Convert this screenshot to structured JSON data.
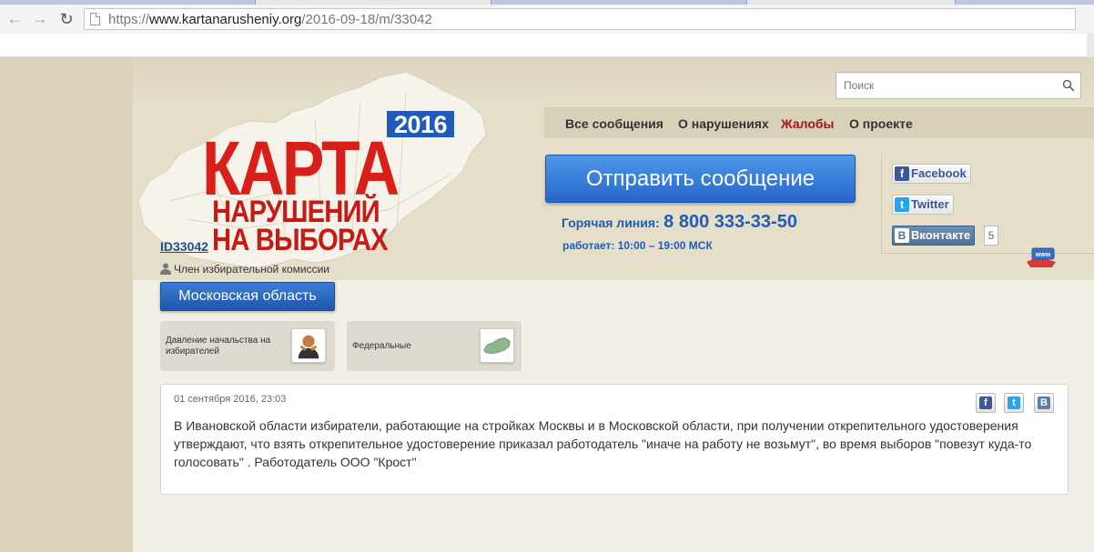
{
  "browser": {
    "url_scheme": "https://",
    "url_domain": "www.kartanarusheniy.org",
    "url_path": "/2016-09-18/m/33042"
  },
  "header": {
    "logo_year": "2016",
    "logo_line1": "КАРТА",
    "logo_line2": "НАРУШЕНИЙ",
    "logo_line3": "НА ВЫБОРАХ",
    "search_placeholder": "Поиск"
  },
  "menu": {
    "items": [
      {
        "label": "Все сообщения",
        "active": false
      },
      {
        "label": "О нарушениях",
        "active": false
      },
      {
        "label": "Жалобы",
        "active": true
      },
      {
        "label": "О проекте",
        "active": false
      }
    ]
  },
  "actions": {
    "send_label": "Отправить сообщение",
    "hotline_label": "Горячая линия:",
    "hotline_number": "8 800 333-33-50",
    "hours": "работает: 10:00 – 19:00 МСК"
  },
  "social": {
    "facebook": "Facebook",
    "twitter": "Twitter",
    "vkontakte": "Вконтакте",
    "vk_count": "5"
  },
  "message": {
    "id": "ID33042",
    "author_role": "Член избирательной комиссии",
    "region": "Московская область",
    "categories": [
      {
        "label": "Давление начальства на избирателей"
      },
      {
        "label": "Федеральные"
      }
    ],
    "date": "01 сентября 2016, 23:03",
    "text": "В Ивановской области избиратели, работающие на стройках Москвы и в Московской области, при получении открепительного удостоверения утверждают, что взять открепительное удостоверение приказал работодатель \"иначе на работу не возьмут\", во время выборов \"повезут куда-то голосовать\" . Работодатель ООО \"Крост\""
  },
  "colors": {
    "brand_red": "#d81f1a",
    "brand_blue": "#1f5cb8",
    "page_bg": "#e3dcc8"
  }
}
